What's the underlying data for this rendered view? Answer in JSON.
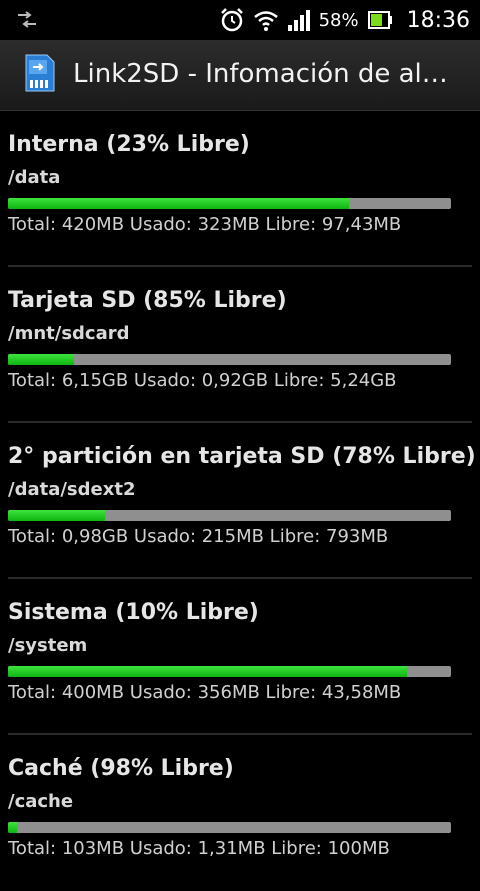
{
  "status_bar": {
    "battery_percent": "58%",
    "time": "18:36",
    "icons": [
      "data-transfer-icon",
      "alarm-clock-icon",
      "wifi-icon",
      "signal-icon",
      "battery-icon"
    ]
  },
  "action_bar": {
    "title": "Link2SD - Infomación de alm…",
    "icon": "sd-card-icon"
  },
  "storage": [
    {
      "title": "Interna (23% Libre)",
      "path": "/data",
      "used_fraction": 0.77,
      "stats": "Total: 420MB Usado: 323MB Libre: 97,43MB"
    },
    {
      "title": "Tarjeta SD (85% Libre)",
      "path": "/mnt/sdcard",
      "used_fraction": 0.15,
      "stats": "Total: 6,15GB Usado: 0,92GB Libre: 5,24GB"
    },
    {
      "title": "2° partición en tarjeta SD (78% Libre)",
      "path": "/data/sdext2",
      "used_fraction": 0.22,
      "stats": "Total: 0,98GB Usado: 215MB Libre: 793MB"
    },
    {
      "title": "Sistema (10% Libre)",
      "path": "/system",
      "used_fraction": 0.9,
      "stats": "Total: 400MB Usado: 356MB Libre: 43,58MB"
    },
    {
      "title": "Caché (98% Libre)",
      "path": "/cache",
      "used_fraction": 0.02,
      "stats": "Total: 103MB Usado: 1,31MB Libre: 100MB"
    }
  ],
  "colors": {
    "bar_used": "#22cc22",
    "bar_track": "#8f8f8f"
  }
}
